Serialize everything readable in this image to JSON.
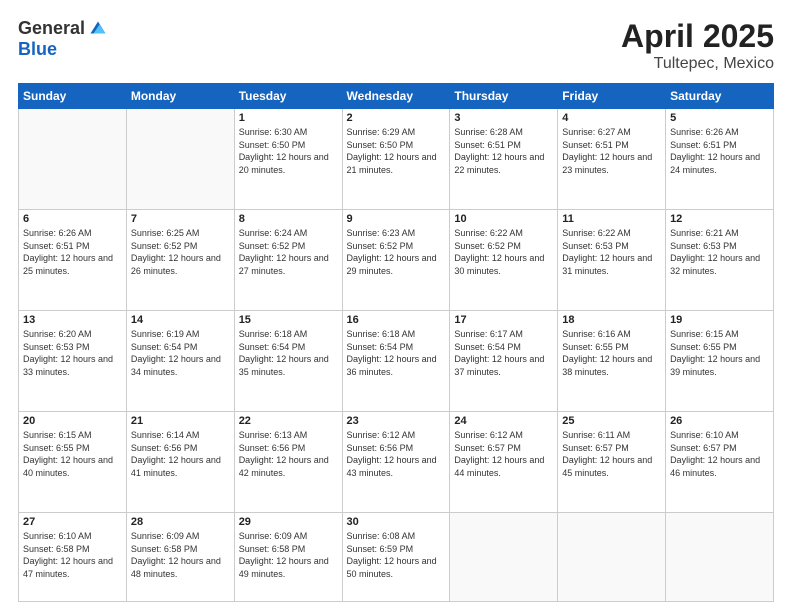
{
  "header": {
    "logo_general": "General",
    "logo_blue": "Blue",
    "main_title": "April 2025",
    "subtitle": "Tultepec, Mexico"
  },
  "calendar": {
    "days_of_week": [
      "Sunday",
      "Monday",
      "Tuesday",
      "Wednesday",
      "Thursday",
      "Friday",
      "Saturday"
    ],
    "weeks": [
      [
        {
          "day": "",
          "info": ""
        },
        {
          "day": "",
          "info": ""
        },
        {
          "day": "1",
          "info": "Sunrise: 6:30 AM\nSunset: 6:50 PM\nDaylight: 12 hours and 20 minutes."
        },
        {
          "day": "2",
          "info": "Sunrise: 6:29 AM\nSunset: 6:50 PM\nDaylight: 12 hours and 21 minutes."
        },
        {
          "day": "3",
          "info": "Sunrise: 6:28 AM\nSunset: 6:51 PM\nDaylight: 12 hours and 22 minutes."
        },
        {
          "day": "4",
          "info": "Sunrise: 6:27 AM\nSunset: 6:51 PM\nDaylight: 12 hours and 23 minutes."
        },
        {
          "day": "5",
          "info": "Sunrise: 6:26 AM\nSunset: 6:51 PM\nDaylight: 12 hours and 24 minutes."
        }
      ],
      [
        {
          "day": "6",
          "info": "Sunrise: 6:26 AM\nSunset: 6:51 PM\nDaylight: 12 hours and 25 minutes."
        },
        {
          "day": "7",
          "info": "Sunrise: 6:25 AM\nSunset: 6:52 PM\nDaylight: 12 hours and 26 minutes."
        },
        {
          "day": "8",
          "info": "Sunrise: 6:24 AM\nSunset: 6:52 PM\nDaylight: 12 hours and 27 minutes."
        },
        {
          "day": "9",
          "info": "Sunrise: 6:23 AM\nSunset: 6:52 PM\nDaylight: 12 hours and 29 minutes."
        },
        {
          "day": "10",
          "info": "Sunrise: 6:22 AM\nSunset: 6:52 PM\nDaylight: 12 hours and 30 minutes."
        },
        {
          "day": "11",
          "info": "Sunrise: 6:22 AM\nSunset: 6:53 PM\nDaylight: 12 hours and 31 minutes."
        },
        {
          "day": "12",
          "info": "Sunrise: 6:21 AM\nSunset: 6:53 PM\nDaylight: 12 hours and 32 minutes."
        }
      ],
      [
        {
          "day": "13",
          "info": "Sunrise: 6:20 AM\nSunset: 6:53 PM\nDaylight: 12 hours and 33 minutes."
        },
        {
          "day": "14",
          "info": "Sunrise: 6:19 AM\nSunset: 6:54 PM\nDaylight: 12 hours and 34 minutes."
        },
        {
          "day": "15",
          "info": "Sunrise: 6:18 AM\nSunset: 6:54 PM\nDaylight: 12 hours and 35 minutes."
        },
        {
          "day": "16",
          "info": "Sunrise: 6:18 AM\nSunset: 6:54 PM\nDaylight: 12 hours and 36 minutes."
        },
        {
          "day": "17",
          "info": "Sunrise: 6:17 AM\nSunset: 6:54 PM\nDaylight: 12 hours and 37 minutes."
        },
        {
          "day": "18",
          "info": "Sunrise: 6:16 AM\nSunset: 6:55 PM\nDaylight: 12 hours and 38 minutes."
        },
        {
          "day": "19",
          "info": "Sunrise: 6:15 AM\nSunset: 6:55 PM\nDaylight: 12 hours and 39 minutes."
        }
      ],
      [
        {
          "day": "20",
          "info": "Sunrise: 6:15 AM\nSunset: 6:55 PM\nDaylight: 12 hours and 40 minutes."
        },
        {
          "day": "21",
          "info": "Sunrise: 6:14 AM\nSunset: 6:56 PM\nDaylight: 12 hours and 41 minutes."
        },
        {
          "day": "22",
          "info": "Sunrise: 6:13 AM\nSunset: 6:56 PM\nDaylight: 12 hours and 42 minutes."
        },
        {
          "day": "23",
          "info": "Sunrise: 6:12 AM\nSunset: 6:56 PM\nDaylight: 12 hours and 43 minutes."
        },
        {
          "day": "24",
          "info": "Sunrise: 6:12 AM\nSunset: 6:57 PM\nDaylight: 12 hours and 44 minutes."
        },
        {
          "day": "25",
          "info": "Sunrise: 6:11 AM\nSunset: 6:57 PM\nDaylight: 12 hours and 45 minutes."
        },
        {
          "day": "26",
          "info": "Sunrise: 6:10 AM\nSunset: 6:57 PM\nDaylight: 12 hours and 46 minutes."
        }
      ],
      [
        {
          "day": "27",
          "info": "Sunrise: 6:10 AM\nSunset: 6:58 PM\nDaylight: 12 hours and 47 minutes."
        },
        {
          "day": "28",
          "info": "Sunrise: 6:09 AM\nSunset: 6:58 PM\nDaylight: 12 hours and 48 minutes."
        },
        {
          "day": "29",
          "info": "Sunrise: 6:09 AM\nSunset: 6:58 PM\nDaylight: 12 hours and 49 minutes."
        },
        {
          "day": "30",
          "info": "Sunrise: 6:08 AM\nSunset: 6:59 PM\nDaylight: 12 hours and 50 minutes."
        },
        {
          "day": "",
          "info": ""
        },
        {
          "day": "",
          "info": ""
        },
        {
          "day": "",
          "info": ""
        }
      ]
    ]
  }
}
